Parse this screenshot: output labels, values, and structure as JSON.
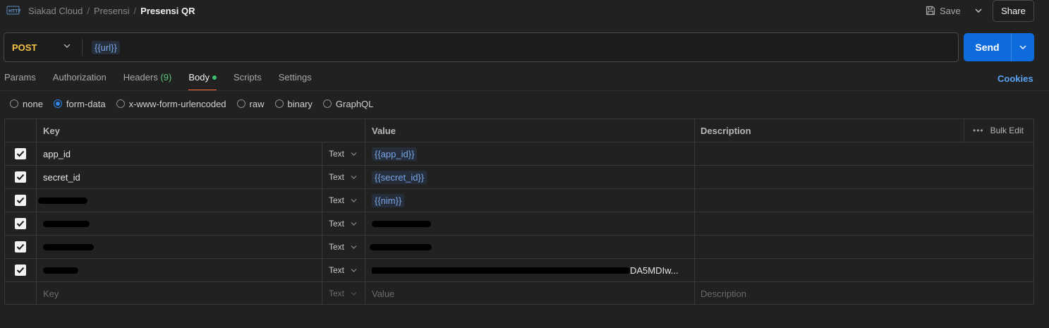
{
  "header": {
    "breadcrumb": [
      "Siakad Cloud",
      "Presensi",
      "Presensi QR"
    ],
    "separator": "/",
    "save_label": "Save",
    "share_label": "Share"
  },
  "request": {
    "method": "POST",
    "url": "{{url}}",
    "send_label": "Send"
  },
  "tabs": [
    {
      "label": "Params"
    },
    {
      "label": "Authorization"
    },
    {
      "label": "Headers",
      "count": "(9)"
    },
    {
      "label": "Body",
      "active": true
    },
    {
      "label": "Scripts"
    },
    {
      "label": "Settings"
    }
  ],
  "cookies_label": "Cookies",
  "body_types": [
    "none",
    "form-data",
    "x-www-form-urlencoded",
    "raw",
    "binary",
    "GraphQL"
  ],
  "body_type_selected": "form-data",
  "table": {
    "headers": {
      "key": "Key",
      "value": "Value",
      "description": "Description",
      "bulk_edit": "Bulk Edit"
    },
    "rows": [
      {
        "key": "app_id",
        "type": "Text",
        "value": "{{app_id}}",
        "value_is_var": true
      },
      {
        "key": "secret_id",
        "type": "Text",
        "value": "{{secret_id}}",
        "value_is_var": true
      },
      {
        "key": "",
        "type": "Text",
        "value": "{{nim}}",
        "value_is_var": true
      },
      {
        "key": "",
        "type": "Text",
        "value": ""
      },
      {
        "key": "",
        "type": "Text",
        "value": ""
      },
      {
        "key": "",
        "type": "Text",
        "value": "DA5MDIw..."
      }
    ],
    "new_row": {
      "key_placeholder": "Key",
      "type": "Text",
      "value_placeholder": "Value",
      "description_placeholder": "Description"
    }
  },
  "colors": {
    "background": "#212121",
    "method": "#f6c445",
    "send": "#0e6bdc",
    "link": "#5aa2f5",
    "active_tab_indicator": "#ff6c37",
    "variable": "#7aa7e8"
  }
}
